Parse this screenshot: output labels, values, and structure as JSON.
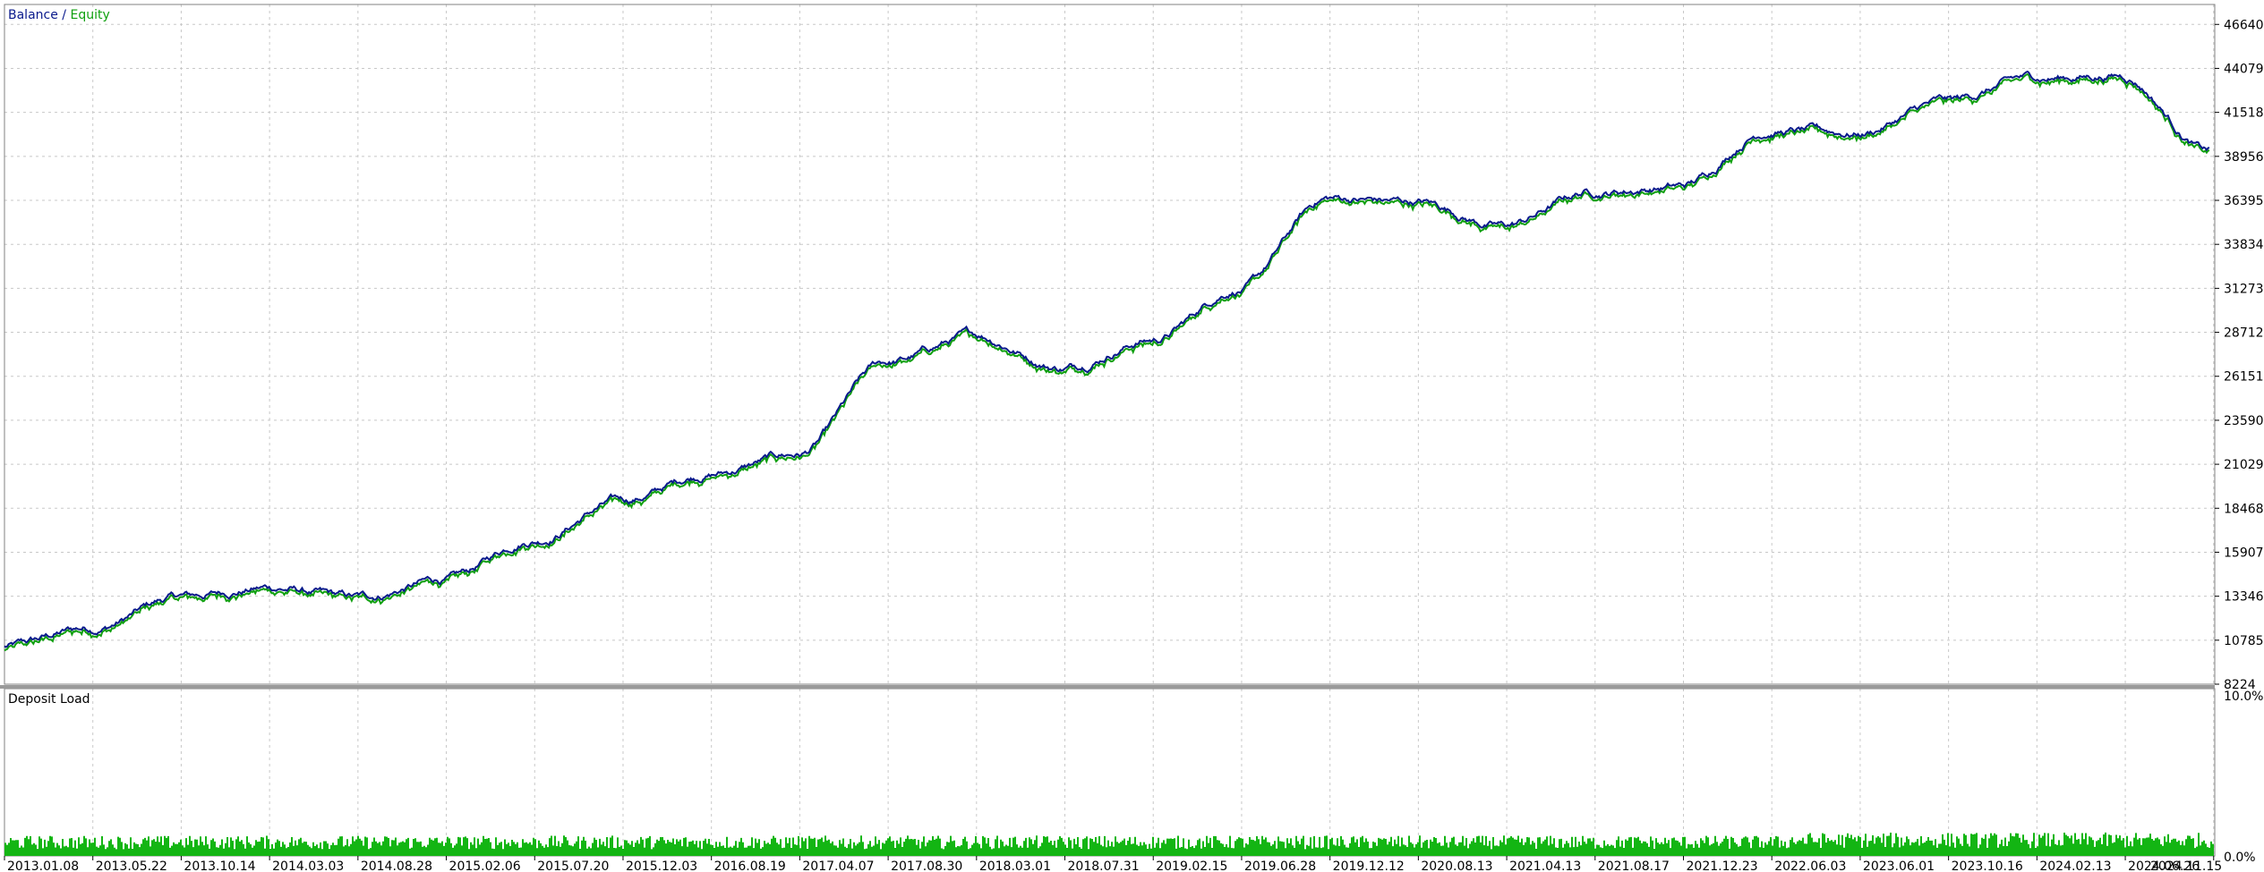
{
  "legend": {
    "balance": "Balance",
    "separator": "/",
    "equity": "Equity"
  },
  "lower_panel": {
    "title": "Deposit Load",
    "y_max_label": "10.0%",
    "y_min_label": "0.0%"
  },
  "colors": {
    "balance": "#0a1a8c",
    "equity": "#10a010",
    "deposit_load": "#13b513",
    "grid": "#c8c8c8",
    "frame": "#808080",
    "text": "#000000"
  },
  "chart_data": {
    "type": "line",
    "series": [
      {
        "name": "Balance",
        "color": "#0a1a8c"
      },
      {
        "name": "Equity",
        "color": "#10a010"
      }
    ],
    "x": [
      "2013.01.08",
      "2013.05.22",
      "2013.10.14",
      "2014.03.03",
      "2014.08.28",
      "2015.02.06",
      "2015.07.20",
      "2015.12.03",
      "2016.08.19",
      "2017.04.07",
      "2017.08.30",
      "2018.03.01",
      "2018.07.31",
      "2019.02.15",
      "2019.06.28",
      "2019.12.12",
      "2020.08.13",
      "2021.04.13",
      "2021.08.17",
      "2021.12.23",
      "2022.06.03",
      "2023.06.01",
      "2023.10.16",
      "2024.02.13",
      "2024.06.26",
      "2024.11.15"
    ],
    "values": [
      10400,
      11500,
      13300,
      13850,
      13200,
      14300,
      16700,
      18900,
      20500,
      21600,
      26900,
      28500,
      26700,
      28300,
      31300,
      36500,
      36300,
      34900,
      36900,
      37200,
      40500,
      40300,
      42100,
      43500,
      43700,
      39300
    ],
    "y_ticks": [
      "46640",
      "44079",
      "41518",
      "38956",
      "36395",
      "33834",
      "31273",
      "28712",
      "26151",
      "23590",
      "21029",
      "18468",
      "15907",
      "13346",
      "10785",
      "8224"
    ],
    "ylim": [
      8224,
      47800
    ],
    "grid": true,
    "legend_position": "top-left",
    "deposit_load": {
      "name": "Deposit Load",
      "unit": "%",
      "ylim": [
        0,
        10
      ],
      "typical_percent": 0.9
    }
  }
}
